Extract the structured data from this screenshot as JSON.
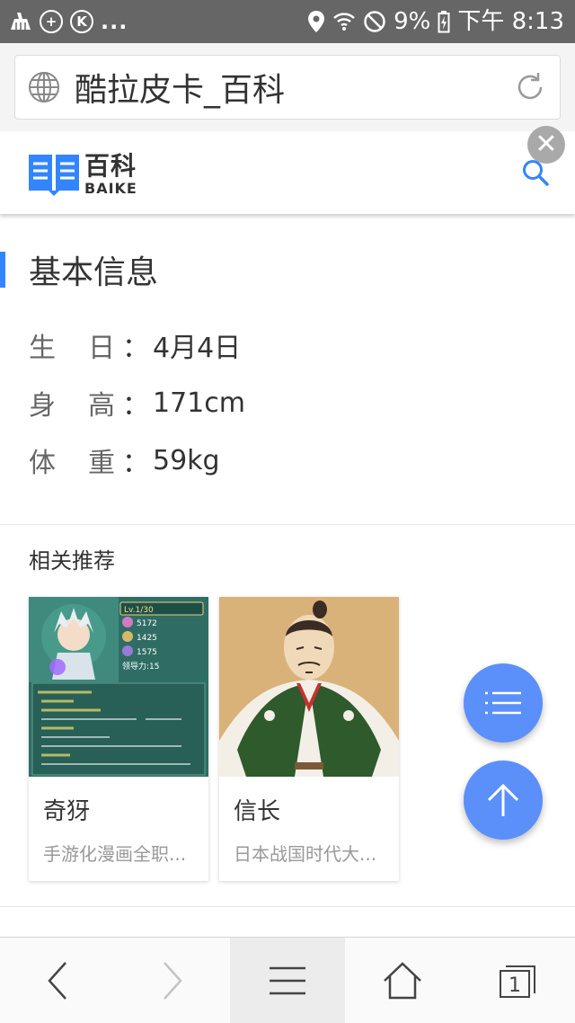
{
  "status_bar": {
    "battery": "9%",
    "time": "下午 8:13",
    "more": "..."
  },
  "address_bar": {
    "title": "酷拉皮卡_百科"
  },
  "baike": {
    "logo_cn": "百科",
    "logo_en": "BAIKE",
    "close_label": "✕"
  },
  "basic_info": {
    "title": "基本信息",
    "rows": [
      {
        "key_1": "生",
        "key_2": "日",
        "colon": "：",
        "value": "4月4日"
      },
      {
        "key_1": "身",
        "key_2": "高",
        "colon": "：",
        "value": "171cm"
      },
      {
        "key_1": "体",
        "key_2": "重",
        "colon": "：",
        "value": "59kg"
      }
    ]
  },
  "related": {
    "title": "相关推荐",
    "items": [
      {
        "name": "奇犽",
        "desc": "手游化漫画全职..."
      },
      {
        "name": "信长",
        "desc": "日本战国时代大..."
      }
    ]
  },
  "game_card": {
    "level": "Lv.1/30",
    "stat_1": "5172",
    "stat_2": "1425",
    "stat_3": "1575",
    "power": "领导力:15"
  },
  "toolbar": {
    "tabs_count": "1"
  },
  "colors": {
    "accent": "#3385ff",
    "fab": "#5b8ff9",
    "status_bar": "#666666"
  }
}
